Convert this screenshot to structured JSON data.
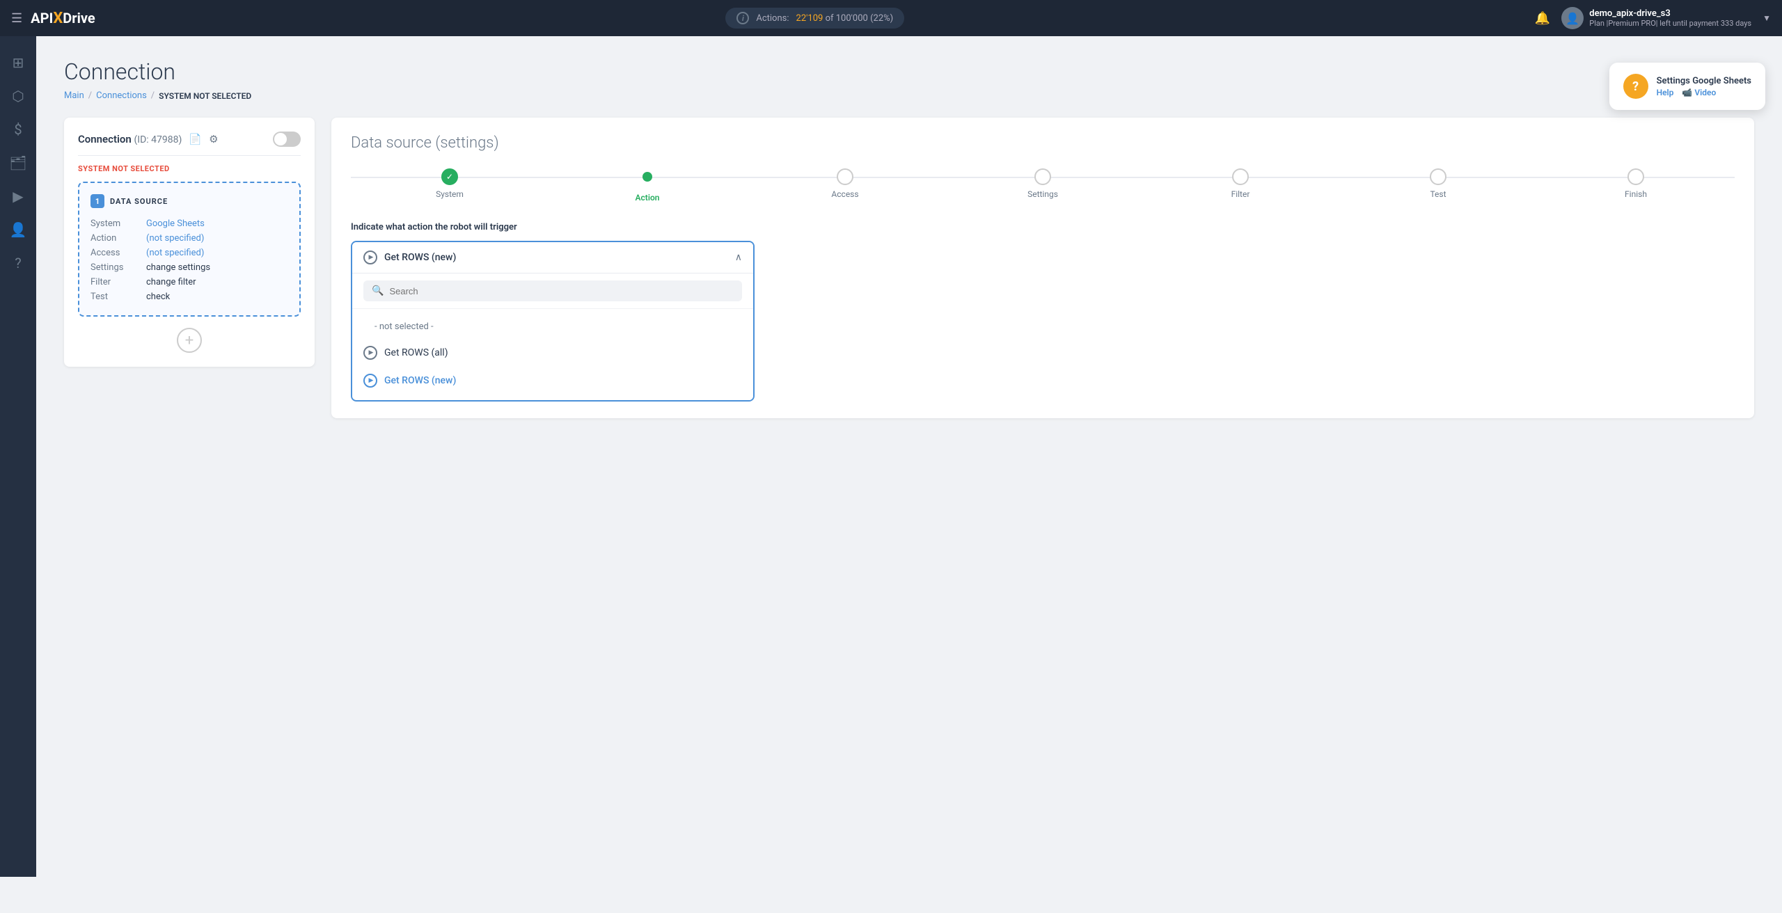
{
  "topnav": {
    "logo": {
      "api": "API",
      "x": "X",
      "drive": "Drive"
    },
    "actions": {
      "label": "Actions:",
      "used": "22'109",
      "of_text": "of",
      "total": "100'000",
      "pct": "(22%)"
    },
    "user": {
      "name": "demo_apix-drive_s3",
      "plan": "Plan |Premium PRO| left until payment 333 days",
      "avatar_icon": "person"
    }
  },
  "sidebar": {
    "items": [
      {
        "icon": "⊞",
        "name": "dashboard-icon"
      },
      {
        "icon": "⬡",
        "name": "connections-icon"
      },
      {
        "icon": "$",
        "name": "billing-icon"
      },
      {
        "icon": "🗂",
        "name": "integrations-icon"
      },
      {
        "icon": "▶",
        "name": "youtube-icon"
      },
      {
        "icon": "👤",
        "name": "profile-icon"
      },
      {
        "icon": "?",
        "name": "help-icon"
      }
    ]
  },
  "page": {
    "title": "Connection",
    "breadcrumb": {
      "main": "Main",
      "connections": "Connections",
      "current": "SYSTEM NOT SELECTED"
    }
  },
  "help_widget": {
    "title": "Settings Google Sheets",
    "help_label": "Help",
    "video_label": "📹 Video"
  },
  "left_panel": {
    "connection_title": "Connection",
    "connection_id": "(ID: 47988)",
    "system_label": "SYSTEM",
    "not_selected": "NOT SELECTED",
    "datasource": {
      "number": "1",
      "label": "DATA SOURCE",
      "rows": [
        {
          "key": "System",
          "value": "Google Sheets",
          "is_link": true,
          "link_type": "normal"
        },
        {
          "key": "Action",
          "value": "(not specified)",
          "is_link": true,
          "link_type": "not-specified"
        },
        {
          "key": "Access",
          "value": "(not specified)",
          "is_link": true,
          "link_type": "not-specified"
        },
        {
          "key": "Settings",
          "value": "change settings",
          "is_link": false
        },
        {
          "key": "Filter",
          "value": "change filter",
          "is_link": false
        },
        {
          "key": "Test",
          "value": "check",
          "is_link": false
        }
      ]
    },
    "add_button_label": "+"
  },
  "right_panel": {
    "title": "Data source",
    "title_sub": "(settings)",
    "steps": [
      {
        "label": "System",
        "state": "done",
        "icon": "✓"
      },
      {
        "label": "Action",
        "state": "active"
      },
      {
        "label": "Access",
        "state": "inactive"
      },
      {
        "label": "Settings",
        "state": "inactive"
      },
      {
        "label": "Filter",
        "state": "inactive"
      },
      {
        "label": "Test",
        "state": "inactive"
      },
      {
        "label": "Finish",
        "state": "inactive"
      }
    ],
    "action_instruction": "Indicate what action the robot will trigger",
    "dropdown": {
      "selected": "Get ROWS (new)",
      "search_placeholder": "Search",
      "options": [
        {
          "label": "- not selected -",
          "type": "not-sel"
        },
        {
          "label": "Get ROWS (all)",
          "type": "normal"
        },
        {
          "label": "Get ROWS (new)",
          "type": "selected"
        }
      ]
    }
  }
}
